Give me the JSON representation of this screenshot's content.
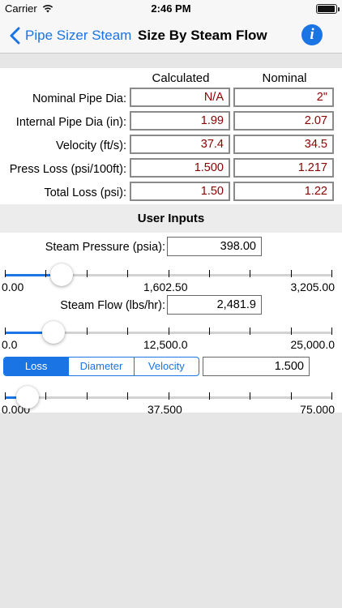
{
  "status_bar": {
    "carrier": "Carrier",
    "time": "2:46 PM"
  },
  "nav": {
    "back_label": "Pipe Sizer Steam",
    "title": "Size By Steam Flow",
    "info_glyph": "i"
  },
  "results": {
    "columns": [
      "Calculated",
      "Nominal"
    ],
    "rows": [
      {
        "label": "Nominal Pipe Dia:",
        "calculated": "N/A",
        "nominal": "2\""
      },
      {
        "label": "Internal Pipe Dia (in):",
        "calculated": "1.99",
        "nominal": "2.07"
      },
      {
        "label": "Velocity (ft/s):",
        "calculated": "37.4",
        "nominal": "34.5"
      },
      {
        "label": "Press Loss (psi/100ft):",
        "calculated": "1.500",
        "nominal": "1.217"
      },
      {
        "label": "Total Loss (psi):",
        "calculated": "1.50",
        "nominal": "1.22"
      }
    ]
  },
  "user_inputs": {
    "header": "User Inputs",
    "steam_pressure": {
      "label": "Steam Pressure (psia):",
      "value": "398.00",
      "slider": {
        "min_label": "0.00",
        "mid_label": "1,602.50",
        "max_label": "3,205.00",
        "fraction": 0.124
      }
    },
    "steam_flow": {
      "label": "Steam Flow (lbs/hr):",
      "value": "2,481.9",
      "slider": {
        "min_label": "0.0",
        "mid_label": "12,500.0",
        "max_label": "25,000.0",
        "fraction": 0.099
      }
    },
    "mode": {
      "segments": [
        "Loss",
        "Diameter",
        "Velocity"
      ],
      "selected": "Loss",
      "value": "1.500",
      "slider": {
        "min_label": "0.000",
        "mid_label": "37.500",
        "max_label": "75.000",
        "fraction": 0.02
      }
    }
  },
  "colors": {
    "accent": "#1b74e4",
    "calculated_text": "#8b0000"
  }
}
